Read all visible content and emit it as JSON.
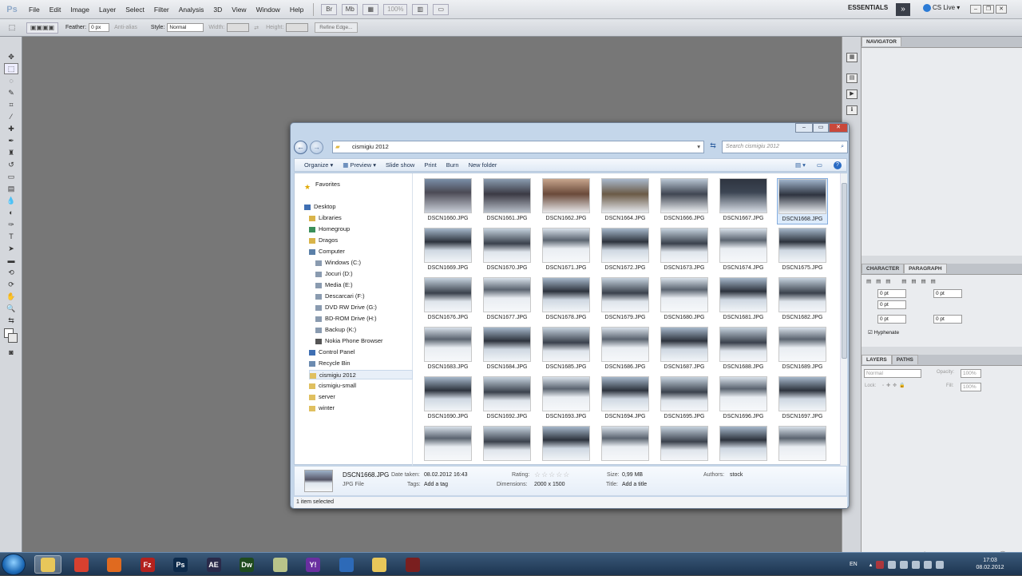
{
  "photoshop": {
    "logo": "Ps",
    "menu": [
      "File",
      "Edit",
      "Image",
      "Layer",
      "Select",
      "Filter",
      "Analysis",
      "3D",
      "View",
      "Window",
      "Help"
    ],
    "zoom": "100%",
    "workspace": "ESSENTIALS",
    "cslive": "CS Live",
    "options": {
      "feather_label": "Feather:",
      "feather_value": "0 px",
      "antialias_label": "Anti-alias",
      "style_label": "Style:",
      "style_value": "Normal",
      "width_label": "Width:",
      "height_label": "Height:",
      "refine_edge": "Refine Edge..."
    },
    "panels": {
      "navigator": "NAVIGATOR",
      "character": "CHARACTER",
      "paragraph": "PARAGRAPH",
      "indent_values": [
        "0 pt",
        "0 pt",
        "0 pt",
        "0 pt",
        "0 pt"
      ],
      "hyphenate": "Hyphenate",
      "layers": "LAYERS",
      "paths": "PATHS",
      "blend_mode": "Normal",
      "opacity_label": "Opacity:",
      "opacity_value": "100%",
      "lock_label": "Lock:",
      "fill_label": "Fill:",
      "fill_value": "100%"
    }
  },
  "explorer": {
    "address": "cismigiu 2012",
    "search_placeholder": "Search cismigiu 2012",
    "commands": [
      "Organize",
      "Preview",
      "Slide show",
      "Print",
      "Burn",
      "New folder"
    ],
    "nav": {
      "favorites": "Favorites",
      "items": [
        {
          "label": "Desktop",
          "color": "#3f6fb3"
        },
        {
          "label": "Libraries",
          "color": "#d9b44a"
        },
        {
          "label": "Homegroup",
          "color": "#3a8f5a"
        },
        {
          "label": "Dragos",
          "color": "#d9b44a"
        },
        {
          "label": "Computer",
          "color": "#5a7fa8"
        },
        {
          "label": "Windows (C:)",
          "color": "#8a9bb0"
        },
        {
          "label": "Jocuri (D:)",
          "color": "#8a9bb0"
        },
        {
          "label": "Media (E:)",
          "color": "#8a9bb0"
        },
        {
          "label": "Descarcari (F:)",
          "color": "#8a9bb0"
        },
        {
          "label": "DVD RW Drive (G:)",
          "color": "#8a9bb0"
        },
        {
          "label": "BD-ROM Drive (H:)",
          "color": "#8a9bb0"
        },
        {
          "label": "Backup (K:)",
          "color": "#8a9bb0"
        },
        {
          "label": "Nokia Phone Browser",
          "color": "#555"
        },
        {
          "label": "Control Panel",
          "color": "#3f6fb3"
        },
        {
          "label": "Recycle Bin",
          "color": "#6c8bb0"
        },
        {
          "label": "cismigiu 2012",
          "color": "#e0c060"
        },
        {
          "label": "cismigiu-small",
          "color": "#e0c060"
        },
        {
          "label": "server",
          "color": "#e0c060"
        },
        {
          "label": "winter",
          "color": "#e0c060"
        }
      ]
    },
    "files": [
      "DSCN1660.JPG",
      "DSCN1661.JPG",
      "DSCN1662.JPG",
      "DSCN1664.JPG",
      "DSCN1666.JPG",
      "DSCN1667.JPG",
      "DSCN1668.JPG",
      "DSCN1669.JPG",
      "DSCN1670.JPG",
      "DSCN1671.JPG",
      "DSCN1672.JPG",
      "DSCN1673.JPG",
      "DSCN1674.JPG",
      "DSCN1675.JPG",
      "DSCN1676.JPG",
      "DSCN1677.JPG",
      "DSCN1678.JPG",
      "DSCN1679.JPG",
      "DSCN1680.JPG",
      "DSCN1681.JPG",
      "DSCN1682.JPG",
      "DSCN1683.JPG",
      "DSCN1684.JPG",
      "DSCN1685.JPG",
      "DSCN1686.JPG",
      "DSCN1687.JPG",
      "DSCN1688.JPG",
      "DSCN1689.JPG",
      "DSCN1690.JPG",
      "DSCN1692.JPG",
      "DSCN1693.JPG",
      "DSCN1694.JPG",
      "DSCN1695.JPG",
      "DSCN1696.JPG",
      "DSCN1697.JPG"
    ],
    "details": {
      "name": "DSCN1668.JPG",
      "type": "JPG File",
      "date_label": "Date taken:",
      "date_value": "08.02.2012 16:43",
      "tags_label": "Tags:",
      "tags_value": "Add a tag",
      "rating_label": "Rating:",
      "dims_label": "Dimensions:",
      "dims_value": "2000 x 1500",
      "size_label": "Size:",
      "size_value": "0,99 MB",
      "title_label": "Title:",
      "title_value": "Add a title",
      "authors_label": "Authors:",
      "authors_value": "stock"
    },
    "status": "1 item selected"
  },
  "taskbar": {
    "apps": [
      {
        "name": "explorer-app",
        "label": "",
        "color": "#e8c75a"
      },
      {
        "name": "chrome-app",
        "label": "",
        "color": "#d8402f"
      },
      {
        "name": "firefox-app",
        "label": "",
        "color": "#e06a1f"
      },
      {
        "name": "filezilla-app",
        "label": "Fz",
        "color": "#b3221e"
      },
      {
        "name": "photoshop-app",
        "label": "Ps",
        "color": "#0d2a4a"
      },
      {
        "name": "aftereffects-app",
        "label": "AE",
        "color": "#2a2a4a"
      },
      {
        "name": "dreamweaver-app",
        "label": "Dw",
        "color": "#1f4b1f"
      },
      {
        "name": "notes-app",
        "label": "",
        "color": "#b9c48a"
      },
      {
        "name": "yahoo-app",
        "label": "Y!",
        "color": "#6a2fa0"
      },
      {
        "name": "messenger-app",
        "label": "",
        "color": "#2d6ab8"
      },
      {
        "name": "folder-app",
        "label": "",
        "color": "#e8c75a"
      },
      {
        "name": "media-app",
        "label": "",
        "color": "#7a1f1f"
      }
    ],
    "language": "EN",
    "time": "17:03",
    "date": "08.02.2012"
  }
}
